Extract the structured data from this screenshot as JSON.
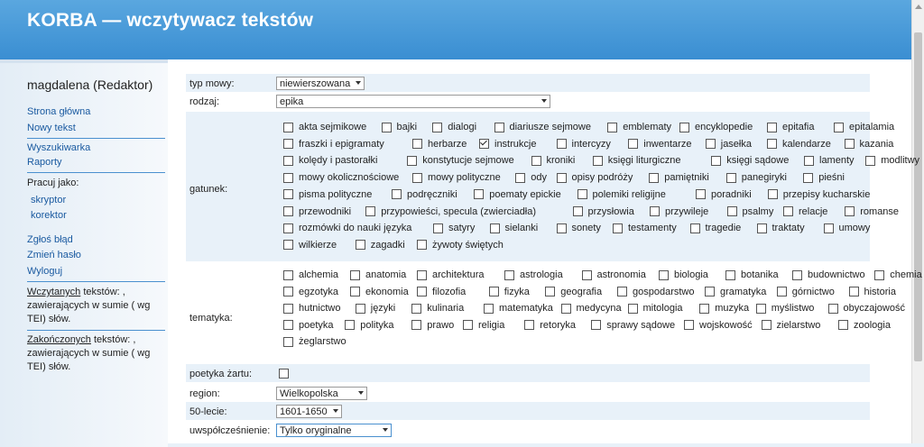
{
  "app": {
    "title": "KORBA — wczytywacz tekstów"
  },
  "sidebar": {
    "user": "magdalena (Redaktor)",
    "links": [
      "Strona główna",
      "Nowy tekst",
      "Wyszukiwarka",
      "Raporty"
    ],
    "work_as": "Pracuj jako:",
    "roles": [
      "skryptor",
      "korektor"
    ],
    "bottom_links": [
      "Zgłoś błąd",
      "Zmień hasło",
      "Wyloguj"
    ],
    "stat1": {
      "link": "Wczytanych",
      "text": " tekstów: , zawierających w sumie ( wg TEI) słów."
    },
    "stat2": {
      "link": "Zakończonych",
      "text": " tekstów: , zawierających w sumie ( wg TEI) słów."
    }
  },
  "form": {
    "typ_mowy": {
      "label": "typ mowy:",
      "value": "niewierszowana"
    },
    "rodzaj": {
      "label": "rodzaj:",
      "value": "epika"
    },
    "gatunek": {
      "label": "gatunek:",
      "rows": [
        [
          [
            "akta sejmikowe",
            false
          ],
          [
            "bajki",
            false
          ],
          [
            "dialogi",
            false
          ],
          [
            "diariusze sejmowe",
            false
          ],
          [
            "emblematy",
            false
          ],
          [
            "encyklopedie",
            false
          ],
          [
            "epitafia",
            false
          ],
          [
            "epitalamia",
            false
          ]
        ],
        [
          [
            "fraszki i epigramaty",
            false
          ],
          [
            "herbarze",
            false
          ],
          [
            "instrukcje",
            true
          ],
          [
            "intercyzy",
            false
          ],
          [
            "inwentarze",
            false
          ],
          [
            "jasełka",
            false
          ],
          [
            "kalendarze",
            false
          ],
          [
            "kazania",
            false
          ]
        ],
        [
          [
            "kolędy i pastorałki",
            false
          ],
          [
            "konstytucje sejmowe",
            false
          ],
          [
            "kroniki",
            false
          ],
          [
            "księgi liturgiczne",
            false
          ],
          [
            "księgi sądowe",
            false
          ],
          [
            "lamenty",
            false
          ],
          [
            "modlitwy",
            false
          ]
        ],
        [
          [
            "mowy okolicznościowe",
            false
          ],
          [
            "mowy polityczne",
            false
          ],
          [
            "ody",
            false
          ],
          [
            "opisy podróży",
            false
          ],
          [
            "pamiętniki",
            false
          ],
          [
            "panegiryki",
            false
          ],
          [
            "pieśni",
            false
          ]
        ],
        [
          [
            "pisma polityczne",
            false
          ],
          [
            "podręczniki",
            false
          ],
          [
            "poematy epickie",
            false
          ],
          [
            "polemiki religijne",
            false
          ],
          [
            "poradniki",
            false
          ],
          [
            "przepisy kucharskie",
            false
          ]
        ],
        [
          [
            "przewodniki",
            false
          ],
          [
            "przypowieści, specula (zwierciadła)",
            false
          ],
          [
            "przysłowia",
            false
          ],
          [
            "przywileje",
            false
          ],
          [
            "psalmy",
            false
          ],
          [
            "relacje",
            false
          ],
          [
            "romanse",
            false
          ]
        ],
        [
          [
            "rozmówki do nauki języka",
            false
          ],
          [
            "satyry",
            false
          ],
          [
            "sielanki",
            false
          ],
          [
            "sonety",
            false
          ],
          [
            "testamenty",
            false
          ],
          [
            "tragedie",
            false
          ],
          [
            "traktaty",
            false
          ],
          [
            "umowy",
            false
          ]
        ],
        [
          [
            "wilkierze",
            false
          ],
          [
            "zagadki",
            false
          ],
          [
            "żywoty świętych",
            false
          ]
        ]
      ]
    },
    "tematyka": {
      "label": "tematyka:",
      "rows": [
        [
          [
            "alchemia",
            false
          ],
          [
            "anatomia",
            false
          ],
          [
            "architektura",
            false
          ],
          [
            "astrologia",
            false
          ],
          [
            "astronomia",
            false
          ],
          [
            "biologia",
            false
          ],
          [
            "botanika",
            false
          ],
          [
            "budownictwo",
            false
          ],
          [
            "chemia",
            false
          ]
        ],
        [
          [
            "egzotyka",
            false
          ],
          [
            "ekonomia",
            false
          ],
          [
            "filozofia",
            false
          ],
          [
            "fizyka",
            false
          ],
          [
            "geografia",
            false
          ],
          [
            "gospodarstwo",
            false
          ],
          [
            "gramatyka",
            false
          ],
          [
            "górnictwo",
            false
          ],
          [
            "historia",
            false
          ]
        ],
        [
          [
            "hutnictwo",
            false
          ],
          [
            "języki",
            false
          ],
          [
            "kulinaria",
            false
          ],
          [
            "matematyka",
            false
          ],
          [
            "medycyna",
            false
          ],
          [
            "mitologia",
            false
          ],
          [
            "muzyka",
            false
          ],
          [
            "myślistwo",
            false
          ],
          [
            "obyczajowość",
            false
          ]
        ],
        [
          [
            "poetyka",
            false
          ],
          [
            "polityka",
            false
          ],
          [
            "prawo",
            false
          ],
          [
            "religia",
            false
          ],
          [
            "retoryka",
            false
          ],
          [
            "sprawy sądowe",
            false
          ],
          [
            "wojskowość",
            false
          ],
          [
            "zielarstwo",
            false
          ],
          [
            "zoologia",
            false
          ]
        ],
        [
          [
            "żeglarstwo",
            false
          ]
        ]
      ]
    },
    "poetyka_zartu": {
      "label": "poetyka żartu:"
    },
    "region": {
      "label": "region:",
      "value": "Wielkopolska"
    },
    "lecie": {
      "label": "50-lecie:",
      "value": "1601-1650"
    },
    "uwspol": {
      "label": "uwspółcześnienie:",
      "value": "Tylko oryginalne"
    }
  }
}
